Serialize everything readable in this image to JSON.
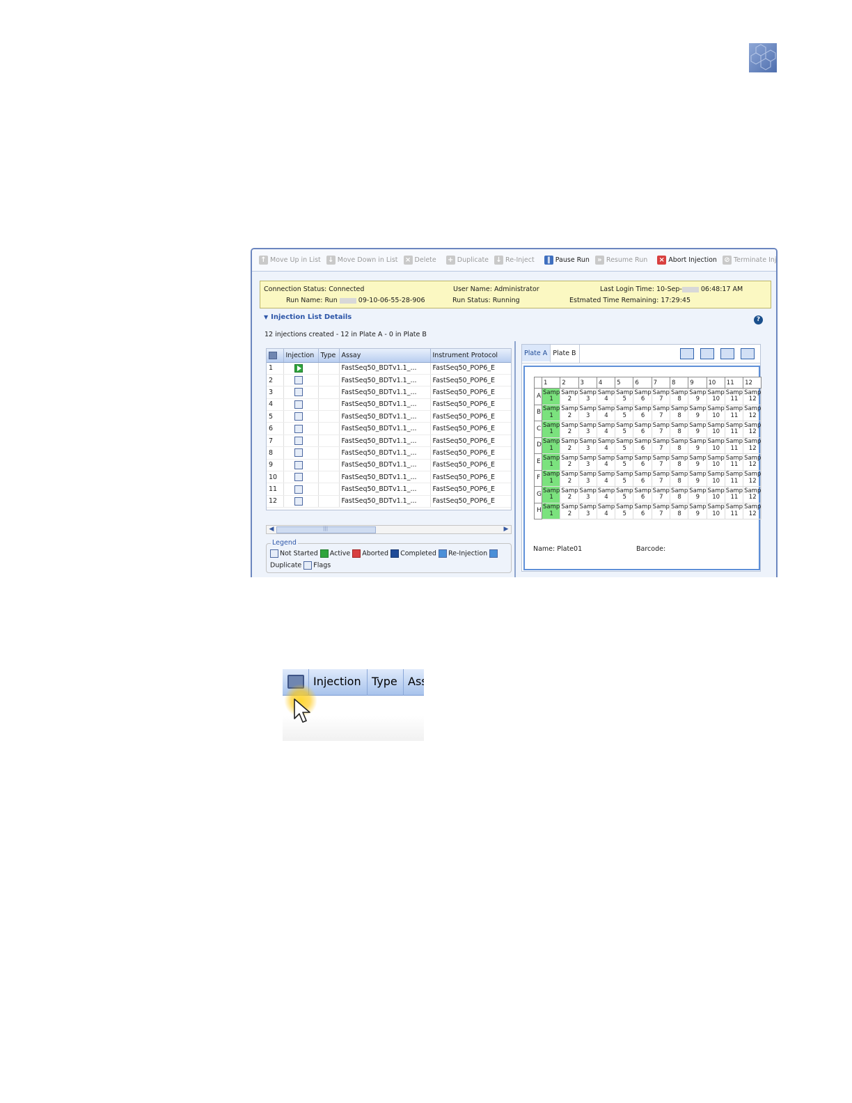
{
  "toolbar": {
    "move_up": "Move Up in List",
    "move_down": "Move Down in List",
    "delete": "Delete",
    "duplicate": "Duplicate",
    "reinject": "Re-Inject",
    "pause": "Pause Run",
    "resume": "Resume Run",
    "abort": "Abort Injection",
    "terminate": "Terminate Injection"
  },
  "status": {
    "connection_label": "Connection Status:",
    "connection_value": "Connected",
    "run_name_label": "Run Name:",
    "run_name_prefix": "Run",
    "run_name_suffix": "09-10-06-55-28-906",
    "user_label": "User Name:",
    "user_value": "Administrator",
    "run_status_label": "Run Status:",
    "run_status_value": "Running",
    "login_label": "Last Login Time:",
    "login_prefix": "10-Sep-",
    "login_suffix": "06:48:17 AM",
    "remaining_label": "Estmated Time Remaining:",
    "remaining_value": "17:29:45"
  },
  "section": {
    "title": "Injection List Details",
    "count": "12 injections created  - 12 in Plate A - 0 in Plate B",
    "help": "?"
  },
  "table": {
    "headers": [
      "Injection",
      "Type",
      "Assay",
      "Instrument Protocol"
    ],
    "rows": [
      {
        "num": "1",
        "state": "active",
        "assay": "FastSeq50_BDTv1.1_...",
        "protocol": "FastSeq50_POP6_E"
      },
      {
        "num": "2",
        "state": "not-started",
        "assay": "FastSeq50_BDTv1.1_...",
        "protocol": "FastSeq50_POP6_E"
      },
      {
        "num": "3",
        "state": "not-started",
        "assay": "FastSeq50_BDTv1.1_...",
        "protocol": "FastSeq50_POP6_E"
      },
      {
        "num": "4",
        "state": "not-started",
        "assay": "FastSeq50_BDTv1.1_...",
        "protocol": "FastSeq50_POP6_E"
      },
      {
        "num": "5",
        "state": "not-started",
        "assay": "FastSeq50_BDTv1.1_...",
        "protocol": "FastSeq50_POP6_E"
      },
      {
        "num": "6",
        "state": "not-started",
        "assay": "FastSeq50_BDTv1.1_...",
        "protocol": "FastSeq50_POP6_E"
      },
      {
        "num": "7",
        "state": "not-started",
        "assay": "FastSeq50_BDTv1.1_...",
        "protocol": "FastSeq50_POP6_E"
      },
      {
        "num": "8",
        "state": "not-started",
        "assay": "FastSeq50_BDTv1.1_...",
        "protocol": "FastSeq50_POP6_E"
      },
      {
        "num": "9",
        "state": "not-started",
        "assay": "FastSeq50_BDTv1.1_...",
        "protocol": "FastSeq50_POP6_E"
      },
      {
        "num": "10",
        "state": "not-started",
        "assay": "FastSeq50_BDTv1.1_...",
        "protocol": "FastSeq50_POP6_E"
      },
      {
        "num": "11",
        "state": "not-started",
        "assay": "FastSeq50_BDTv1.1_...",
        "protocol": "FastSeq50_POP6_E"
      },
      {
        "num": "12",
        "state": "not-started",
        "assay": "FastSeq50_BDTv1.1_...",
        "protocol": "FastSeq50_POP6_E"
      }
    ],
    "scroll_grip": "|||"
  },
  "legend": {
    "title": "Legend",
    "not_started": "Not Started",
    "active": "Active",
    "aborted": "Aborted",
    "completed": "Completed",
    "reinjection": "Re-Injection",
    "duplicate": "Duplicate",
    "flags": "Flags"
  },
  "plate": {
    "tabs": [
      "Plate A",
      "Plate B"
    ],
    "columns": [
      "1",
      "2",
      "3",
      "4",
      "5",
      "6",
      "7",
      "8",
      "9",
      "10",
      "11",
      "12"
    ],
    "rows": [
      "A",
      "B",
      "C",
      "D",
      "E",
      "F",
      "G",
      "H"
    ],
    "cell_label": "Samp",
    "name_label": "Name:",
    "name_value": "Plate01",
    "barcode_label": "Barcode:"
  },
  "inset": {
    "headers": [
      "Injection",
      "Type",
      "Ass"
    ]
  },
  "colors": {
    "active_well": "#7be27e",
    "status_bar": "#fbf8c2",
    "accent": "#2d56a8"
  }
}
